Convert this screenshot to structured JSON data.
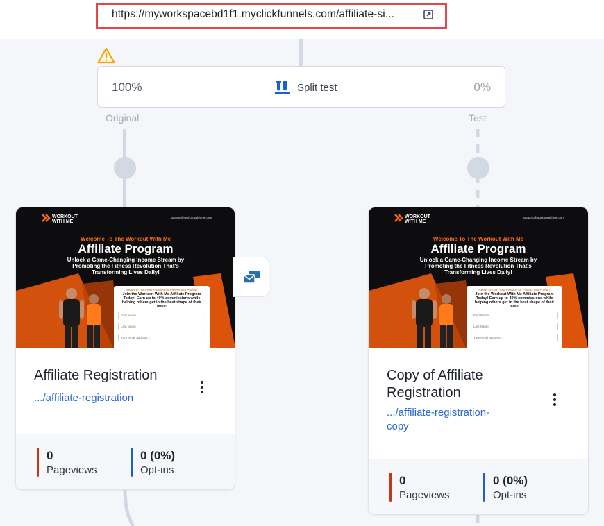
{
  "browser": {
    "url": "https://myworkspacebd1f1.myclickfunnels.com/affiliate-si..."
  },
  "split_test": {
    "original_percent": "100%",
    "label": "Split test",
    "test_percent": "0%",
    "original_label": "Original",
    "test_label": "Test"
  },
  "pages": [
    {
      "thumbnail": {
        "brand": "WORKOUT WITH ME",
        "support_email": "support@workoutwithme.com",
        "welcome": "Welcome To The Workout With Me",
        "heading": "Affiliate Program",
        "subheading": "Unlock a Game-Changing Income Stream by Promoting the Fitness Revolution That's Transforming Lives Daily!",
        "form_question": "Ready to Turn Your Passion for Fitness Into Profits?",
        "form_heading": "Join the Workout With Me Affiliate Program Today! Earn up to 40% commissions while helping others get in the best shape of their lives!",
        "fields": [
          "First Name",
          "Last Name",
          "Your email address..."
        ]
      },
      "title": "Affiliate Registration",
      "link": ".../affiliate-registration",
      "stats": [
        {
          "value": "0",
          "label": "Pageviews"
        },
        {
          "value": "0 (0%)",
          "label": "Opt-ins"
        }
      ]
    },
    {
      "thumbnail": {
        "brand": "WORKOUT WITH ME",
        "support_email": "support@workoutwithme.com",
        "welcome": "Welcome To The Workout With Me",
        "heading": "Affiliate Program",
        "subheading": "Unlock a Game-Changing Income Stream by Promoting the Fitness Revolution That's Transforming Lives Daily!",
        "form_question": "Ready to Turn Your Passion for Fitness Into Profits?",
        "form_heading": "Join the Workout With Me Affiliate Program Today! Earn up to 40% commissions while helping others get in the best shape of their lives!",
        "fields": [
          "First Name",
          "Last Name",
          "Your email address..."
        ]
      },
      "title_line1": "Copy of Affiliate",
      "title_line2": "Registration",
      "link_line1": ".../affiliate-registration-",
      "link_line2": "copy",
      "stats": [
        {
          "value": "0",
          "label": "Pageviews"
        },
        {
          "value": "0 (0%)",
          "label": "Opt-ins"
        }
      ]
    }
  ],
  "colors": {
    "url_highlight": "#e4474f",
    "link": "#2a68d4",
    "pageviews_bar": "#c0391b",
    "optins_bar": "#1a5fd6",
    "accent_orange": "#ff6a1a",
    "connector": "#d3d9e2"
  },
  "icons": {
    "external": "external-link-icon",
    "warning": "warning-icon",
    "split": "split-test-icon",
    "menu": "kebab-menu-icon",
    "email": "email-step-icon"
  }
}
